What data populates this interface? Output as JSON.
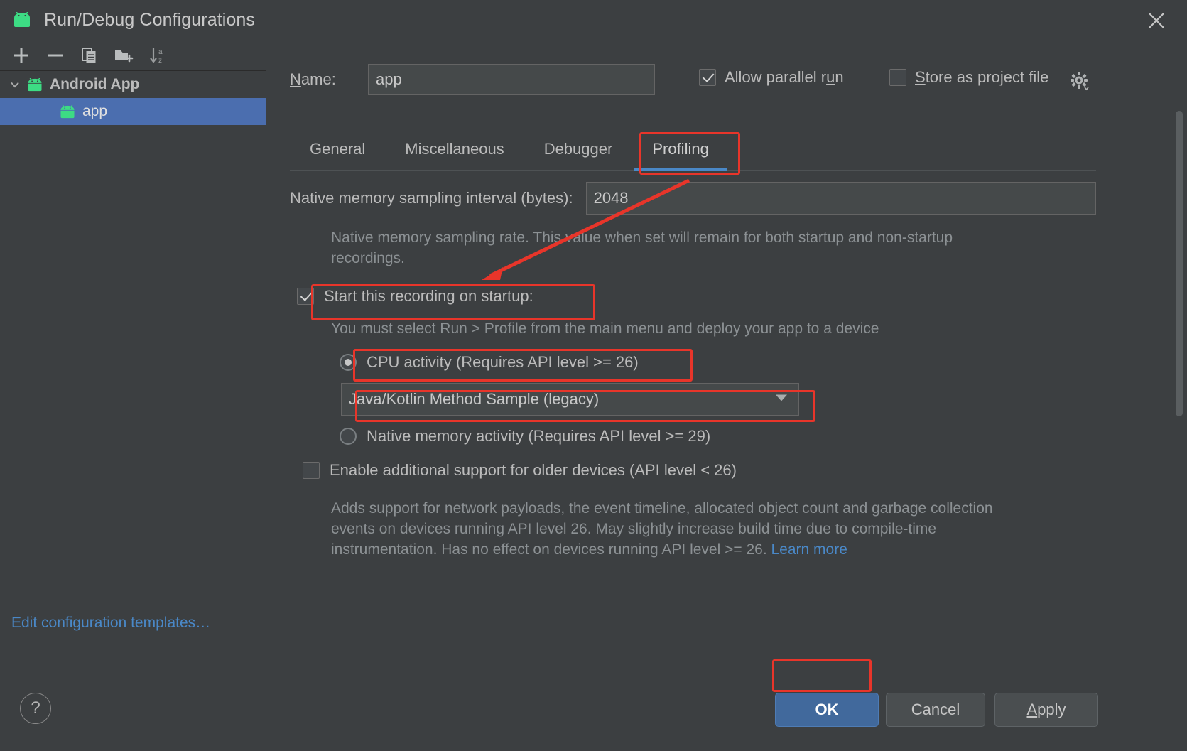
{
  "window": {
    "title": "Run/Debug Configurations",
    "app_icon": "android-robot-icon",
    "close_icon": "close-icon"
  },
  "sidebar": {
    "toolbar": [
      {
        "name": "add-configuration-button",
        "icon": "plus-icon",
        "label": "+"
      },
      {
        "name": "remove-configuration-button",
        "icon": "minus-icon",
        "label": "−"
      },
      {
        "name": "copy-configuration-button",
        "icon": "copy-icon",
        "label": "copy"
      },
      {
        "name": "move-to-folder-button",
        "icon": "folder-add-icon",
        "label": "folder"
      },
      {
        "name": "sort-configurations-button",
        "icon": "sort-alpha-icon",
        "label": "sort a-z"
      }
    ],
    "tree": {
      "group_label": "Android App",
      "group_icon": "android-robot-icon",
      "child_label": "app",
      "child_icon": "android-robot-icon",
      "expanded_icon": "chevron-down-icon"
    },
    "edit_templates_label": "Edit configuration templates…"
  },
  "header": {
    "name_label": "Name:",
    "name_mnemonic": "N",
    "name_value": "app",
    "name_placeholder": "Name",
    "allow_parallel_run": {
      "label": "Allow parallel run",
      "mnemonic": "u",
      "checked": true
    },
    "store_as_project_file": {
      "label": "Store as project file",
      "mnemonic": "S",
      "checked": false
    },
    "settings_icon": "gear-icon"
  },
  "tabs": [
    {
      "label": "General",
      "active": false
    },
    {
      "label": "Miscellaneous",
      "active": false
    },
    {
      "label": "Debugger",
      "active": false
    },
    {
      "label": "Profiling",
      "active": true
    }
  ],
  "profiling": {
    "sampling_interval_label": "Native memory sampling interval (bytes):",
    "sampling_interval_value": "2048",
    "sampling_interval_placeholder": "2048",
    "sampling_interval_hint": "Native memory sampling rate. This value when set will remain for both startup and non-startup recordings.",
    "start_on_startup": {
      "label": "Start this recording on startup:",
      "checked": true
    },
    "startup_hint": "You must select Run > Profile from the main menu and deploy your app to a device",
    "cpu_activity": {
      "label": "CPU activity (Requires API level >= 26)",
      "selected": true
    },
    "method_select": {
      "value": "Java/Kotlin Method Sample (legacy)",
      "arrow_icon": "chevron-down-icon"
    },
    "native_memory_activity": {
      "label": "Native memory activity (Requires API level >= 29)",
      "selected": false
    },
    "older_devices": {
      "label": "Enable additional support for older devices (API level < 26)",
      "checked": false
    },
    "older_devices_description": "Adds support for network payloads, the event timeline, allocated object count and garbage collection events on devices running API level 26. May slightly increase build time due to compile-time instrumentation. Has no effect on devices running API level >= 26.",
    "learn_more_label": "Learn more"
  },
  "footer": {
    "help_label": "?",
    "ok_label": "OK",
    "cancel_label": "Cancel",
    "apply_label": "Apply",
    "apply_mnemonic": "A"
  },
  "annotations": {
    "highlight_color": "#e8352a",
    "items": [
      "profiling-tab",
      "start-this-recording-on-startup-checkbox",
      "cpu-activity-radio",
      "method-select",
      "ok-button"
    ],
    "arrow": "red-arrow-pointing-to-start-recording"
  },
  "colors": {
    "background": "#3c3f41",
    "selection": "#4b6eaf",
    "accent_link": "#4a88c7",
    "primary_button": "#41699c",
    "android_green": "#3ddc84"
  }
}
